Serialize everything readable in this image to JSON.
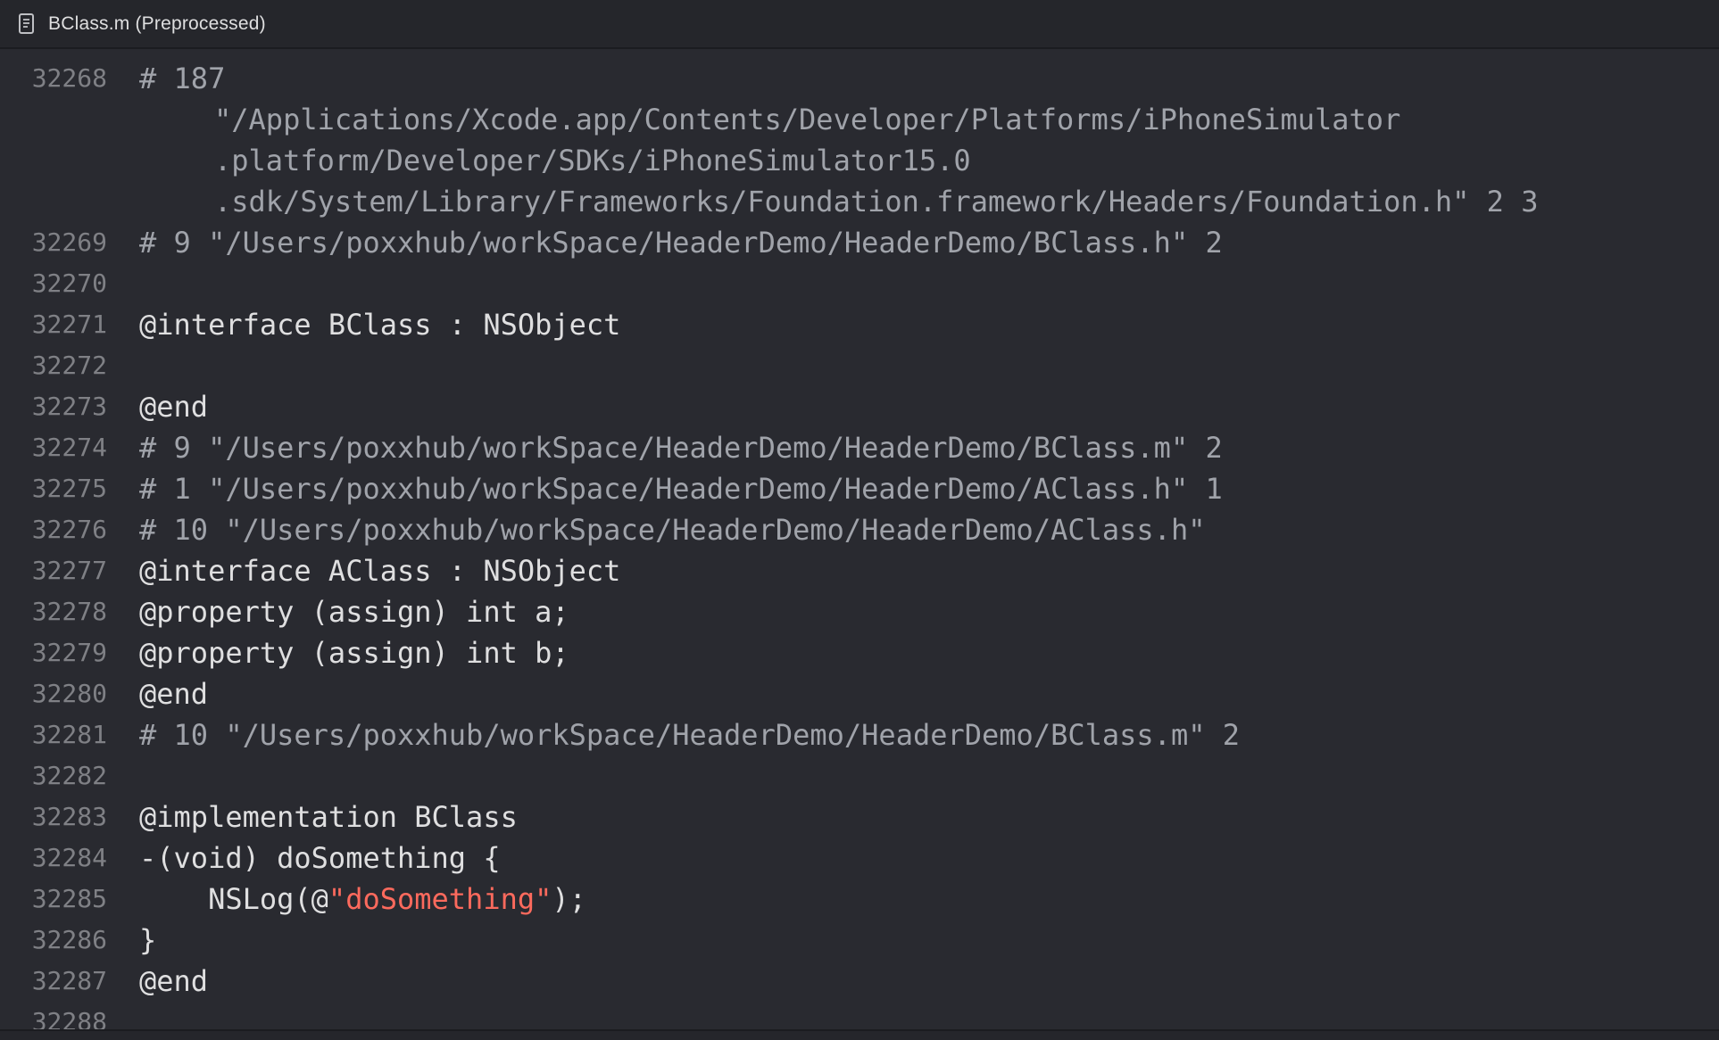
{
  "window": {
    "title": "BClass.m (Preprocessed)",
    "icon": "document-icon"
  },
  "lines": [
    {
      "num": "32268",
      "cls": "preproc",
      "text": "# 187"
    },
    {
      "num": "",
      "cls": "preproc",
      "cont": true,
      "text": "\"/Applications/Xcode.app/Contents/Developer/Platforms/iPhoneSimulator"
    },
    {
      "num": "",
      "cls": "preproc",
      "cont": true,
      "text": ".platform/Developer/SDKs/iPhoneSimulator15.0"
    },
    {
      "num": "",
      "cls": "preproc",
      "cont": true,
      "text": ".sdk/System/Library/Frameworks/Foundation.framework/Headers/Foundation.h\" 2 3"
    },
    {
      "num": "32269",
      "cls": "preproc",
      "text": "# 9 \"/Users/poxxhub/workSpace/HeaderDemo/HeaderDemo/BClass.h\" 2"
    },
    {
      "num": "32270",
      "cls": "plain",
      "text": ""
    },
    {
      "num": "32271",
      "cls": "plain",
      "text": "@interface BClass : NSObject"
    },
    {
      "num": "32272",
      "cls": "plain",
      "text": ""
    },
    {
      "num": "32273",
      "cls": "plain",
      "text": "@end"
    },
    {
      "num": "32274",
      "cls": "preproc",
      "text": "# 9 \"/Users/poxxhub/workSpace/HeaderDemo/HeaderDemo/BClass.m\" 2"
    },
    {
      "num": "32275",
      "cls": "preproc",
      "text": "# 1 \"/Users/poxxhub/workSpace/HeaderDemo/HeaderDemo/AClass.h\" 1"
    },
    {
      "num": "32276",
      "cls": "preproc",
      "text": "# 10 \"/Users/poxxhub/workSpace/HeaderDemo/HeaderDemo/AClass.h\""
    },
    {
      "num": "32277",
      "cls": "plain",
      "text": "@interface AClass : NSObject"
    },
    {
      "num": "32278",
      "cls": "plain",
      "text": "@property (assign) int a;"
    },
    {
      "num": "32279",
      "cls": "plain",
      "text": "@property (assign) int b;"
    },
    {
      "num": "32280",
      "cls": "plain",
      "text": "@end"
    },
    {
      "num": "32281",
      "cls": "preproc",
      "text": "# 10 \"/Users/poxxhub/workSpace/HeaderDemo/HeaderDemo/BClass.m\" 2"
    },
    {
      "num": "32282",
      "cls": "plain",
      "text": ""
    },
    {
      "num": "32283",
      "cls": "plain",
      "text": "@implementation BClass"
    },
    {
      "num": "32284",
      "cls": "plain",
      "text": "-(void) doSomething {"
    },
    {
      "num": "32285",
      "cls": "plain",
      "segments": [
        {
          "cls": "plain",
          "text": "    NSLog(@"
        },
        {
          "cls": "str",
          "text": "\"doSomething\""
        },
        {
          "cls": "plain",
          "text": ");"
        }
      ]
    },
    {
      "num": "32286",
      "cls": "plain",
      "text": "}"
    },
    {
      "num": "32287",
      "cls": "plain",
      "text": "@end"
    },
    {
      "num": "32288",
      "cls": "plain",
      "text": ""
    }
  ],
  "colors": {
    "background": "#292a30",
    "titlebar": "#25262b",
    "plain_text": "#dfdfe0",
    "preprocessor": "#a0a3aa",
    "string": "#fc6a5d",
    "line_number": "#7f8085"
  }
}
